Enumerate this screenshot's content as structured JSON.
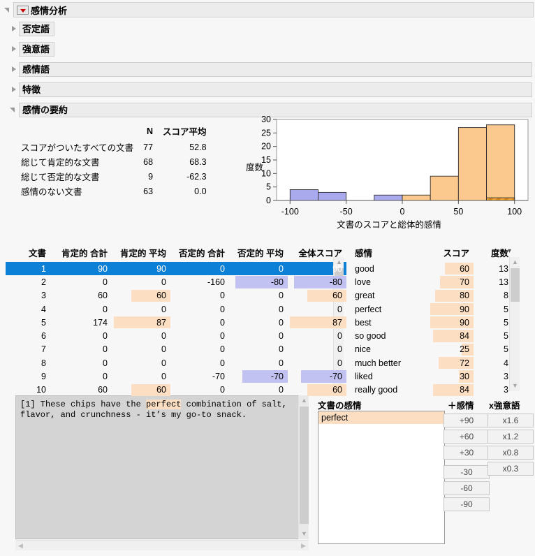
{
  "window": {
    "title": "感情分析",
    "menu_icon": "red-triangle-menu-icon"
  },
  "sections": [
    {
      "label": "否定語",
      "expanded": false,
      "full_width": false
    },
    {
      "label": "強意語",
      "expanded": false,
      "full_width": false
    },
    {
      "label": "感情語",
      "expanded": false,
      "full_width": true
    },
    {
      "label": "特徴",
      "expanded": false,
      "full_width": true
    },
    {
      "label": "感情の要約",
      "expanded": true,
      "full_width": true
    }
  ],
  "summary": {
    "headers": [
      "",
      "N",
      "スコア平均"
    ],
    "rows": [
      {
        "label": "スコアがついたすべての文書",
        "n": "77",
        "mean": "52.8"
      },
      {
        "label": "総じて肯定的な文書",
        "n": "68",
        "mean": "68.3"
      },
      {
        "label": "総じて否定的な文書",
        "n": "9",
        "mean": "-62.3"
      },
      {
        "label": "感情のない文書",
        "n": "63",
        "mean": "0.0"
      }
    ]
  },
  "chart_data": {
    "type": "bar",
    "title": "",
    "xlabel": "文書のスコアと総体的感情",
    "ylabel": "度数",
    "xlim": [
      -112,
      112
    ],
    "ylim": [
      0,
      30
    ],
    "yticks": [
      0,
      5,
      10,
      15,
      20,
      25,
      30
    ],
    "xticks": [
      -100,
      -50,
      0,
      50,
      100
    ],
    "grid": false,
    "bin_width": 25,
    "bins": [
      {
        "x0": -100,
        "x1": -75,
        "value": 4,
        "color": "#a9a9ee"
      },
      {
        "x0": -75,
        "x1": -50,
        "value": 3,
        "color": "#a9a9ee"
      },
      {
        "x0": -25,
        "x1": 0,
        "value": 2,
        "color": "#a9a9ee"
      },
      {
        "x0": 0,
        "x1": 25,
        "value": 2,
        "color": "#fbc98e"
      },
      {
        "x0": 25,
        "x1": 50,
        "value": 9,
        "color": "#fbc98e"
      },
      {
        "x0": 50,
        "x1": 75,
        "value": 27,
        "color": "#fbc98e"
      },
      {
        "x0": 75,
        "x1": 100,
        "value": 28,
        "color": "#fbc98e",
        "selected_value": 1
      }
    ],
    "colors": {
      "negative": "#a9a9ee",
      "positive": "#fbc98e",
      "selected_hatch": "#d98b1e"
    }
  },
  "doc_table": {
    "headers": [
      "文書",
      "肯定的 合計",
      "肯定的 平均",
      "否定的 合計",
      "否定的 平均",
      "全体スコア"
    ],
    "rows": [
      {
        "doc": "1",
        "pos_sum": "90",
        "pos_avg": "90",
        "neg_sum": "0",
        "neg_avg": "0",
        "overall": "90",
        "selected": true
      },
      {
        "doc": "2",
        "pos_sum": "0",
        "pos_avg": "0",
        "neg_sum": "-160",
        "neg_avg": "-80",
        "overall": "-80"
      },
      {
        "doc": "3",
        "pos_sum": "60",
        "pos_avg": "60",
        "neg_sum": "0",
        "neg_avg": "0",
        "overall": "60"
      },
      {
        "doc": "4",
        "pos_sum": "0",
        "pos_avg": "0",
        "neg_sum": "0",
        "neg_avg": "0",
        "overall": "0"
      },
      {
        "doc": "5",
        "pos_sum": "174",
        "pos_avg": "87",
        "neg_sum": "0",
        "neg_avg": "0",
        "overall": "87"
      },
      {
        "doc": "6",
        "pos_sum": "0",
        "pos_avg": "0",
        "neg_sum": "0",
        "neg_avg": "0",
        "overall": "0"
      },
      {
        "doc": "7",
        "pos_sum": "0",
        "pos_avg": "0",
        "neg_sum": "0",
        "neg_avg": "0",
        "overall": "0"
      },
      {
        "doc": "8",
        "pos_sum": "0",
        "pos_avg": "0",
        "neg_sum": "0",
        "neg_avg": "0",
        "overall": "0"
      },
      {
        "doc": "9",
        "pos_sum": "0",
        "pos_avg": "0",
        "neg_sum": "-70",
        "neg_avg": "-70",
        "overall": "-70"
      },
      {
        "doc": "10",
        "pos_sum": "60",
        "pos_avg": "60",
        "neg_sum": "0",
        "neg_avg": "0",
        "overall": "60"
      }
    ]
  },
  "sentiment_table": {
    "headers": [
      "感情",
      "スコア",
      "度数"
    ],
    "sort_icon": "chevron-down-icon",
    "rows": [
      {
        "term": "good",
        "score": "60",
        "count": "13"
      },
      {
        "term": "love",
        "score": "70",
        "count": "13"
      },
      {
        "term": "great",
        "score": "80",
        "count": "8"
      },
      {
        "term": "perfect",
        "score": "90",
        "count": "5"
      },
      {
        "term": "best",
        "score": "90",
        "count": "5"
      },
      {
        "term": "so good",
        "score": "84",
        "count": "5"
      },
      {
        "term": "nice",
        "score": "25",
        "count": "5"
      },
      {
        "term": "much better",
        "score": "72",
        "count": "4"
      },
      {
        "term": "liked",
        "score": "30",
        "count": "3"
      },
      {
        "term": "really good",
        "score": "84",
        "count": "3"
      }
    ]
  },
  "text_view": {
    "prefix": "[1] These chips have the ",
    "highlight": "perfect",
    "suffix": " combination of salt,\nflavor, and crunchness - it’s my go-to snack."
  },
  "doc_sentiment": {
    "label": "文書の感情",
    "items": [
      "perfect"
    ]
  },
  "score_buttons": {
    "label": "＋感情",
    "values": [
      "+90",
      "+60",
      "+30",
      "-30",
      "-60",
      "-90"
    ]
  },
  "amplifier_buttons": {
    "label": "x強意語",
    "values": [
      "x1.6",
      "x1.2",
      "x0.8",
      "x0.3"
    ]
  }
}
